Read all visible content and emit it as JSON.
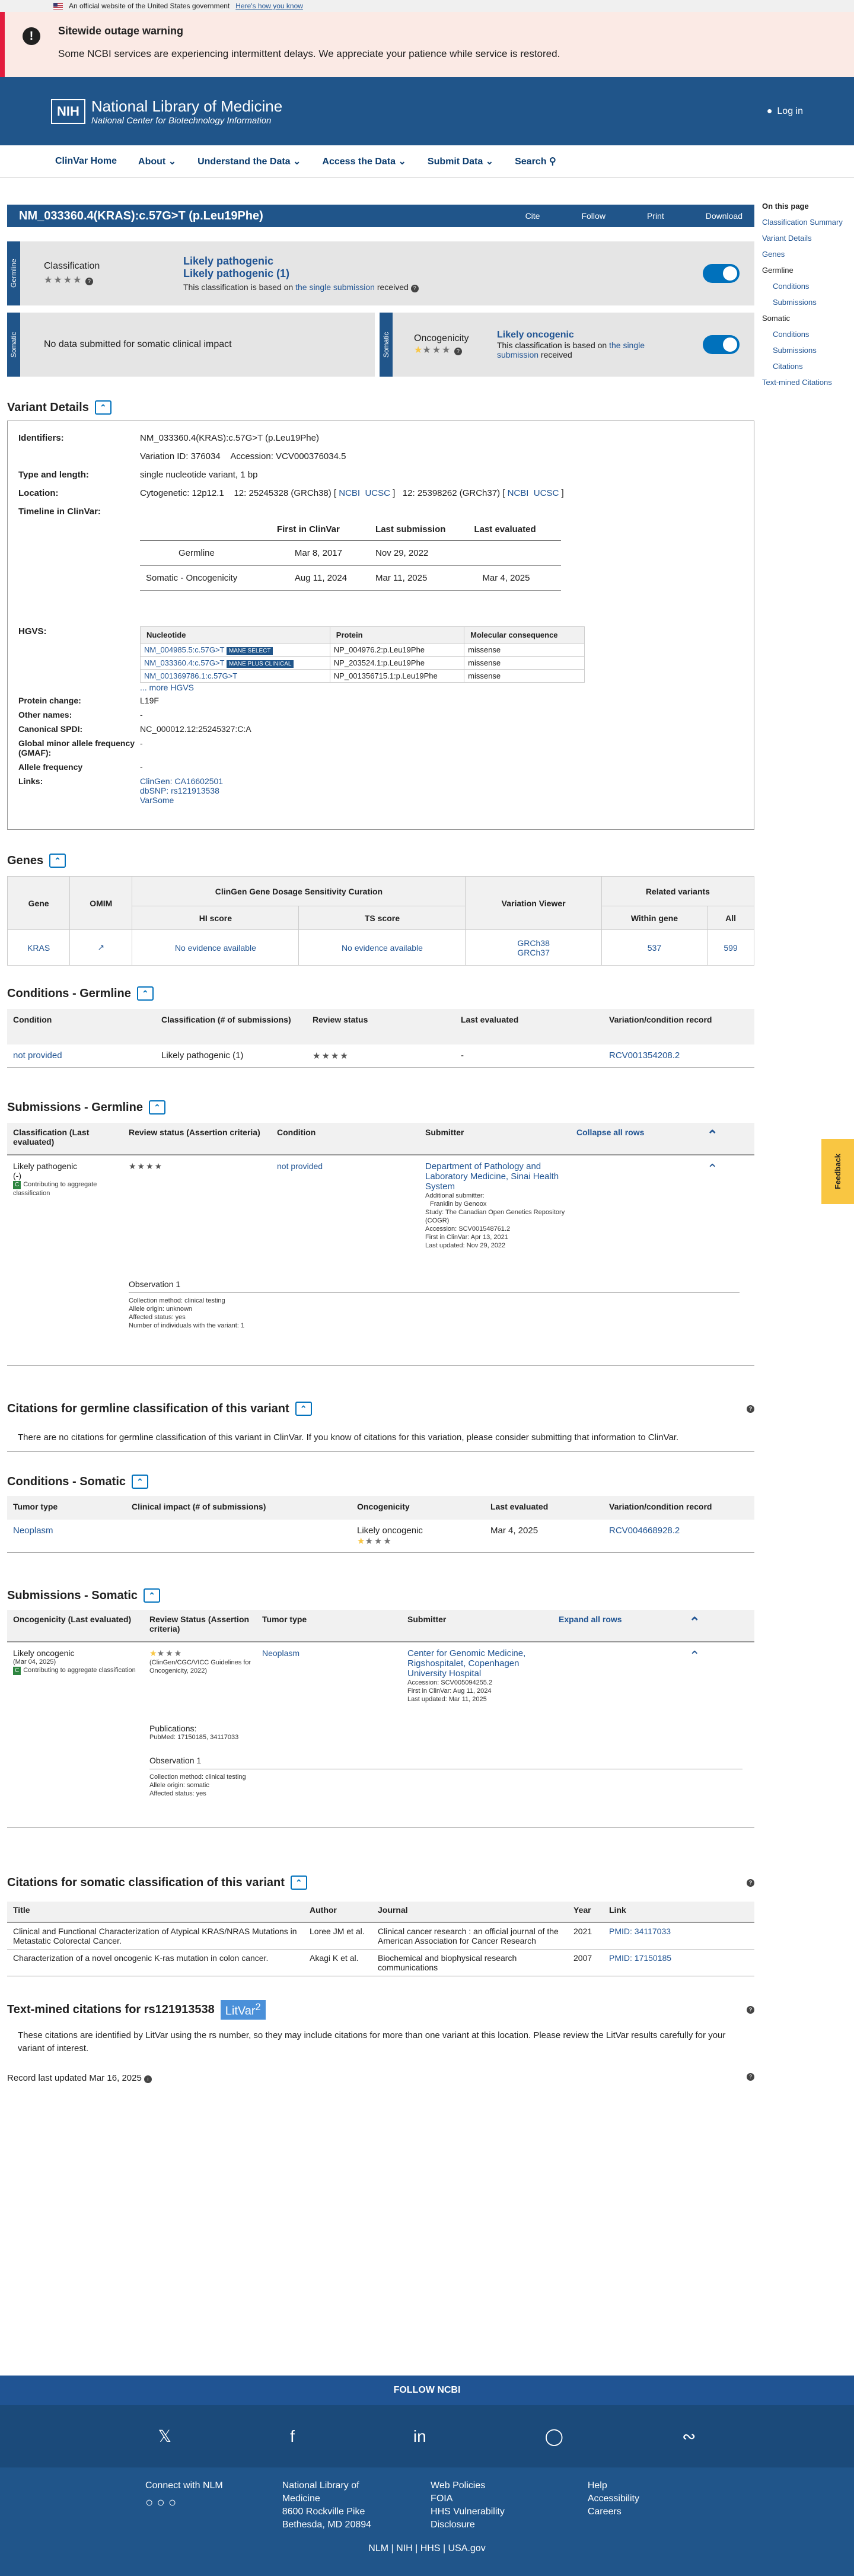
{
  "banner": {
    "text": "An official website of the United States government",
    "link": "Here's how you know"
  },
  "outage": {
    "title": "Sitewide outage warning",
    "message": "Some NCBI services are experiencing intermittent delays. We appreciate your patience while service is restored."
  },
  "header": {
    "logo": "NIH",
    "title": "National Library of Medicine",
    "subtitle": "National Center for Biotechnology Information",
    "login": "Log in"
  },
  "nav": [
    "ClinVar Home",
    "About",
    "Understand the Data",
    "Access the Data",
    "Submit Data",
    "Search"
  ],
  "right_nav": {
    "title": "On this page",
    "items": [
      "Classification Summary",
      "Variant Details",
      "Genes",
      "Germline",
      "Conditions",
      "Submissions",
      "Somatic",
      "Conditions",
      "Submissions",
      "Citations",
      "Text-mined Citations"
    ]
  },
  "title_bar": {
    "title": "NM_033360.4(KRAS):c.57G>T (p.Leu19Phe)",
    "actions": [
      "Cite",
      "Follow",
      "Print",
      "Download"
    ]
  },
  "germline": {
    "label": "Germline",
    "classification_label": "Classification",
    "class1": "Likely pathogenic",
    "class2": "Likely pathogenic (1)",
    "basis": "This classification is based on",
    "basis_link": "the single submission",
    "received": "received"
  },
  "somatic": {
    "label": "Somatic",
    "clinical": "No data submitted for somatic clinical impact",
    "oncogenicity_label": "Oncogenicity",
    "oncogenicity": "Likely oncogenic",
    "basis": "This classification is based on",
    "basis_link": "the single submission",
    "received": "received"
  },
  "variant_details": {
    "title": "Variant Details",
    "identifiers_label": "Identifiers:",
    "identifiers": "NM_033360.4(KRAS):c.57G>T (p.Leu19Phe)",
    "variation_id": "Variation ID: 376034",
    "accession": "Accession: VCV000376034.5",
    "type_label": "Type and length:",
    "type": "single nucleotide variant, 1 bp",
    "location_label": "Location:",
    "cytogenetic": "Cytogenetic: 12p12.1",
    "grch38": "12: 25245328 (GRCh38)",
    "grch37": "12: 25398262 (GRCh37)",
    "ncbi": "NCBI",
    "ucsc": "UCSC",
    "timeline_label": "Timeline in ClinVar:",
    "timeline_headers": [
      "",
      "First in ClinVar",
      "Last submission",
      "Last evaluated"
    ],
    "timeline_rows": [
      [
        "Germline",
        "Mar 8, 2017",
        "Nov 29, 2022",
        ""
      ],
      [
        "Somatic - Oncogenicity",
        "Aug 11, 2024",
        "Mar 11, 2025",
        "Mar 4, 2025"
      ]
    ],
    "hgvs_label": "HGVS:",
    "hgvs_headers": [
      "Nucleotide",
      "Protein",
      "Molecular consequence"
    ],
    "hgvs_rows": [
      [
        "NM_004985.5:c.57G>T",
        "MANE SELECT",
        "NP_004976.2:p.Leu19Phe",
        "missense"
      ],
      [
        "NM_033360.4:c.57G>T",
        "MANE PLUS CLINICAL",
        "NP_203524.1:p.Leu19Phe",
        "missense"
      ],
      [
        "NM_001369786.1:c.57G>T",
        "",
        "NP_001356715.1:p.Leu19Phe",
        "missense"
      ]
    ],
    "more_hgvs": "... more HGVS",
    "protein_change_label": "Protein change:",
    "protein_change": "L19F",
    "other_names_label": "Other names:",
    "other_names": "-",
    "spdi_label": "Canonical SPDI:",
    "spdi": "NC_000012.12:25245327:C:A",
    "gmaf_label": "Global minor allele frequency (GMAF):",
    "gmaf": "-",
    "af_label": "Allele frequency",
    "af": "-",
    "links_label": "Links:",
    "links": [
      "ClinGen: CA16602501",
      "dbSNP: rs121913538",
      "VarSome"
    ]
  },
  "genes": {
    "title": "Genes",
    "headers": [
      "Gene",
      "OMIM",
      "ClinGen Gene Dosage Sensitivity Curation",
      "Variation Viewer",
      "Related variants"
    ],
    "sub_headers": [
      "HI score",
      "TS score",
      "Within gene",
      "All"
    ],
    "row": {
      "gene": "KRAS",
      "hi": "No evidence available",
      "ts": "No evidence available",
      "viewer1": "GRCh38",
      "viewer2": "GRCh37",
      "within": "537",
      "all": "599"
    }
  },
  "cond_germ": {
    "title": "Conditions - Germline",
    "headers": [
      "Condition",
      "Classification (# of submissions)",
      "Review status",
      "Last evaluated",
      "Variation/condition record"
    ],
    "row": {
      "condition": "not provided",
      "classification": "Likely pathogenic (1)",
      "last": "-",
      "record": "RCV001354208.2"
    }
  },
  "sub_germ": {
    "title": "Submissions - Germline",
    "headers": [
      "Classification (Last evaluated)",
      "Review status (Assertion criteria)",
      "Condition",
      "Submitter",
      "Collapse all rows"
    ],
    "row": {
      "classification": "Likely pathogenic",
      "paren": "(-)",
      "contrib": "Contributing to aggregate classification",
      "condition": "not provided",
      "submitter": "Department of Pathology and Laboratory Medicine, Sinai Health System",
      "details": [
        "Additional submitter:",
        "Franklin by Genoox",
        "Study: The Canadian Open Genetics Repository (COGR)",
        "Accession: SCV001548761.2",
        "First in ClinVar: Apr 13, 2021",
        "Last updated: Nov 29, 2022"
      ],
      "obs_title": "Observation 1",
      "obs": [
        "Collection method: clinical testing",
        "Allele origin: unknown",
        "Affected status: yes",
        "Number of individuals with the variant: 1"
      ]
    }
  },
  "cit_germ": {
    "title": "Citations for germline classification of this variant",
    "text": "There are no citations for germline classification of this variant in ClinVar. If you know of citations for this variation, please consider submitting that information to ClinVar."
  },
  "cond_som": {
    "title": "Conditions - Somatic",
    "headers": [
      "Tumor type",
      "Clinical impact (# of submissions)",
      "Oncogenicity",
      "Last evaluated",
      "Variation/condition record"
    ],
    "row": {
      "tumor": "Neoplasm",
      "onc": "Likely oncogenic",
      "last": "Mar 4, 2025",
      "record": "RCV004668928.2"
    }
  },
  "sub_som": {
    "title": "Submissions - Somatic",
    "headers": [
      "Oncogenicity (Last evaluated)",
      "Review Status (Assertion criteria)",
      "Tumor type",
      "Submitter",
      "Expand all rows"
    ],
    "row": {
      "onc": "Likely oncogenic",
      "date": "(Mar 04, 2025)",
      "contrib": "Contributing to aggregate classification",
      "criteria": "(ClinGen/CGC/VICC Guidelines for Oncogenicity, 2022)",
      "tumor": "Neoplasm",
      "submitter": "Center for Genomic Medicine, Rigshospitalet, Copenhagen University Hospital",
      "details": [
        "Accession: SCV005094255.2",
        "First in ClinVar: Aug 11, 2024",
        "Last updated: Mar 11, 2025"
      ],
      "pub_label": "Publications:",
      "pub": "PubMed: 17150185, 34117033",
      "obs_title": "Observation 1",
      "obs": [
        "Collection method: clinical testing",
        "Allele origin: somatic",
        "Affected status: yes"
      ]
    }
  },
  "cit_som": {
    "title": "Citations for somatic classification of this variant",
    "headers": [
      "Title",
      "Author",
      "Journal",
      "Year",
      "Link"
    ],
    "rows": [
      [
        "Clinical and Functional Characterization of Atypical KRAS/NRAS Mutations in Metastatic Colorectal Cancer.",
        "Loree JM et al.",
        "Clinical cancer research : an official journal of the American Association for Cancer Research",
        "2021",
        "PMID: 34117033"
      ],
      [
        "Characterization of a novel oncogenic K-ras mutation in colon cancer.",
        "Akagi K et al.",
        "Biochemical and biophysical research communications",
        "2007",
        "PMID: 17150185"
      ]
    ]
  },
  "textmined": {
    "title": "Text-mined citations for rs121913538",
    "litvar": "LitVar",
    "litvar_num": "2",
    "text": "These citations are identified by LitVar using the rs number, so they may include citations for more than one variant at this location. Please review the LitVar results carefully for your variant of interest."
  },
  "record_updated": "Record last updated Mar 16, 2025",
  "feedback": "Feedback",
  "footer": {
    "follow": "FOLLOW NCBI",
    "connect": "Connect with NLM",
    "address": [
      "National Library of",
      "Medicine",
      "8600 Rockville Pike",
      "Bethesda, MD 20894"
    ],
    "links1": [
      "Web Policies",
      "FOIA",
      "HHS Vulnerability",
      "Disclosure"
    ],
    "links2": [
      "Help",
      "Accessibility",
      "Careers"
    ],
    "bottom": "NLM | NIH | HHS | USA.gov"
  }
}
